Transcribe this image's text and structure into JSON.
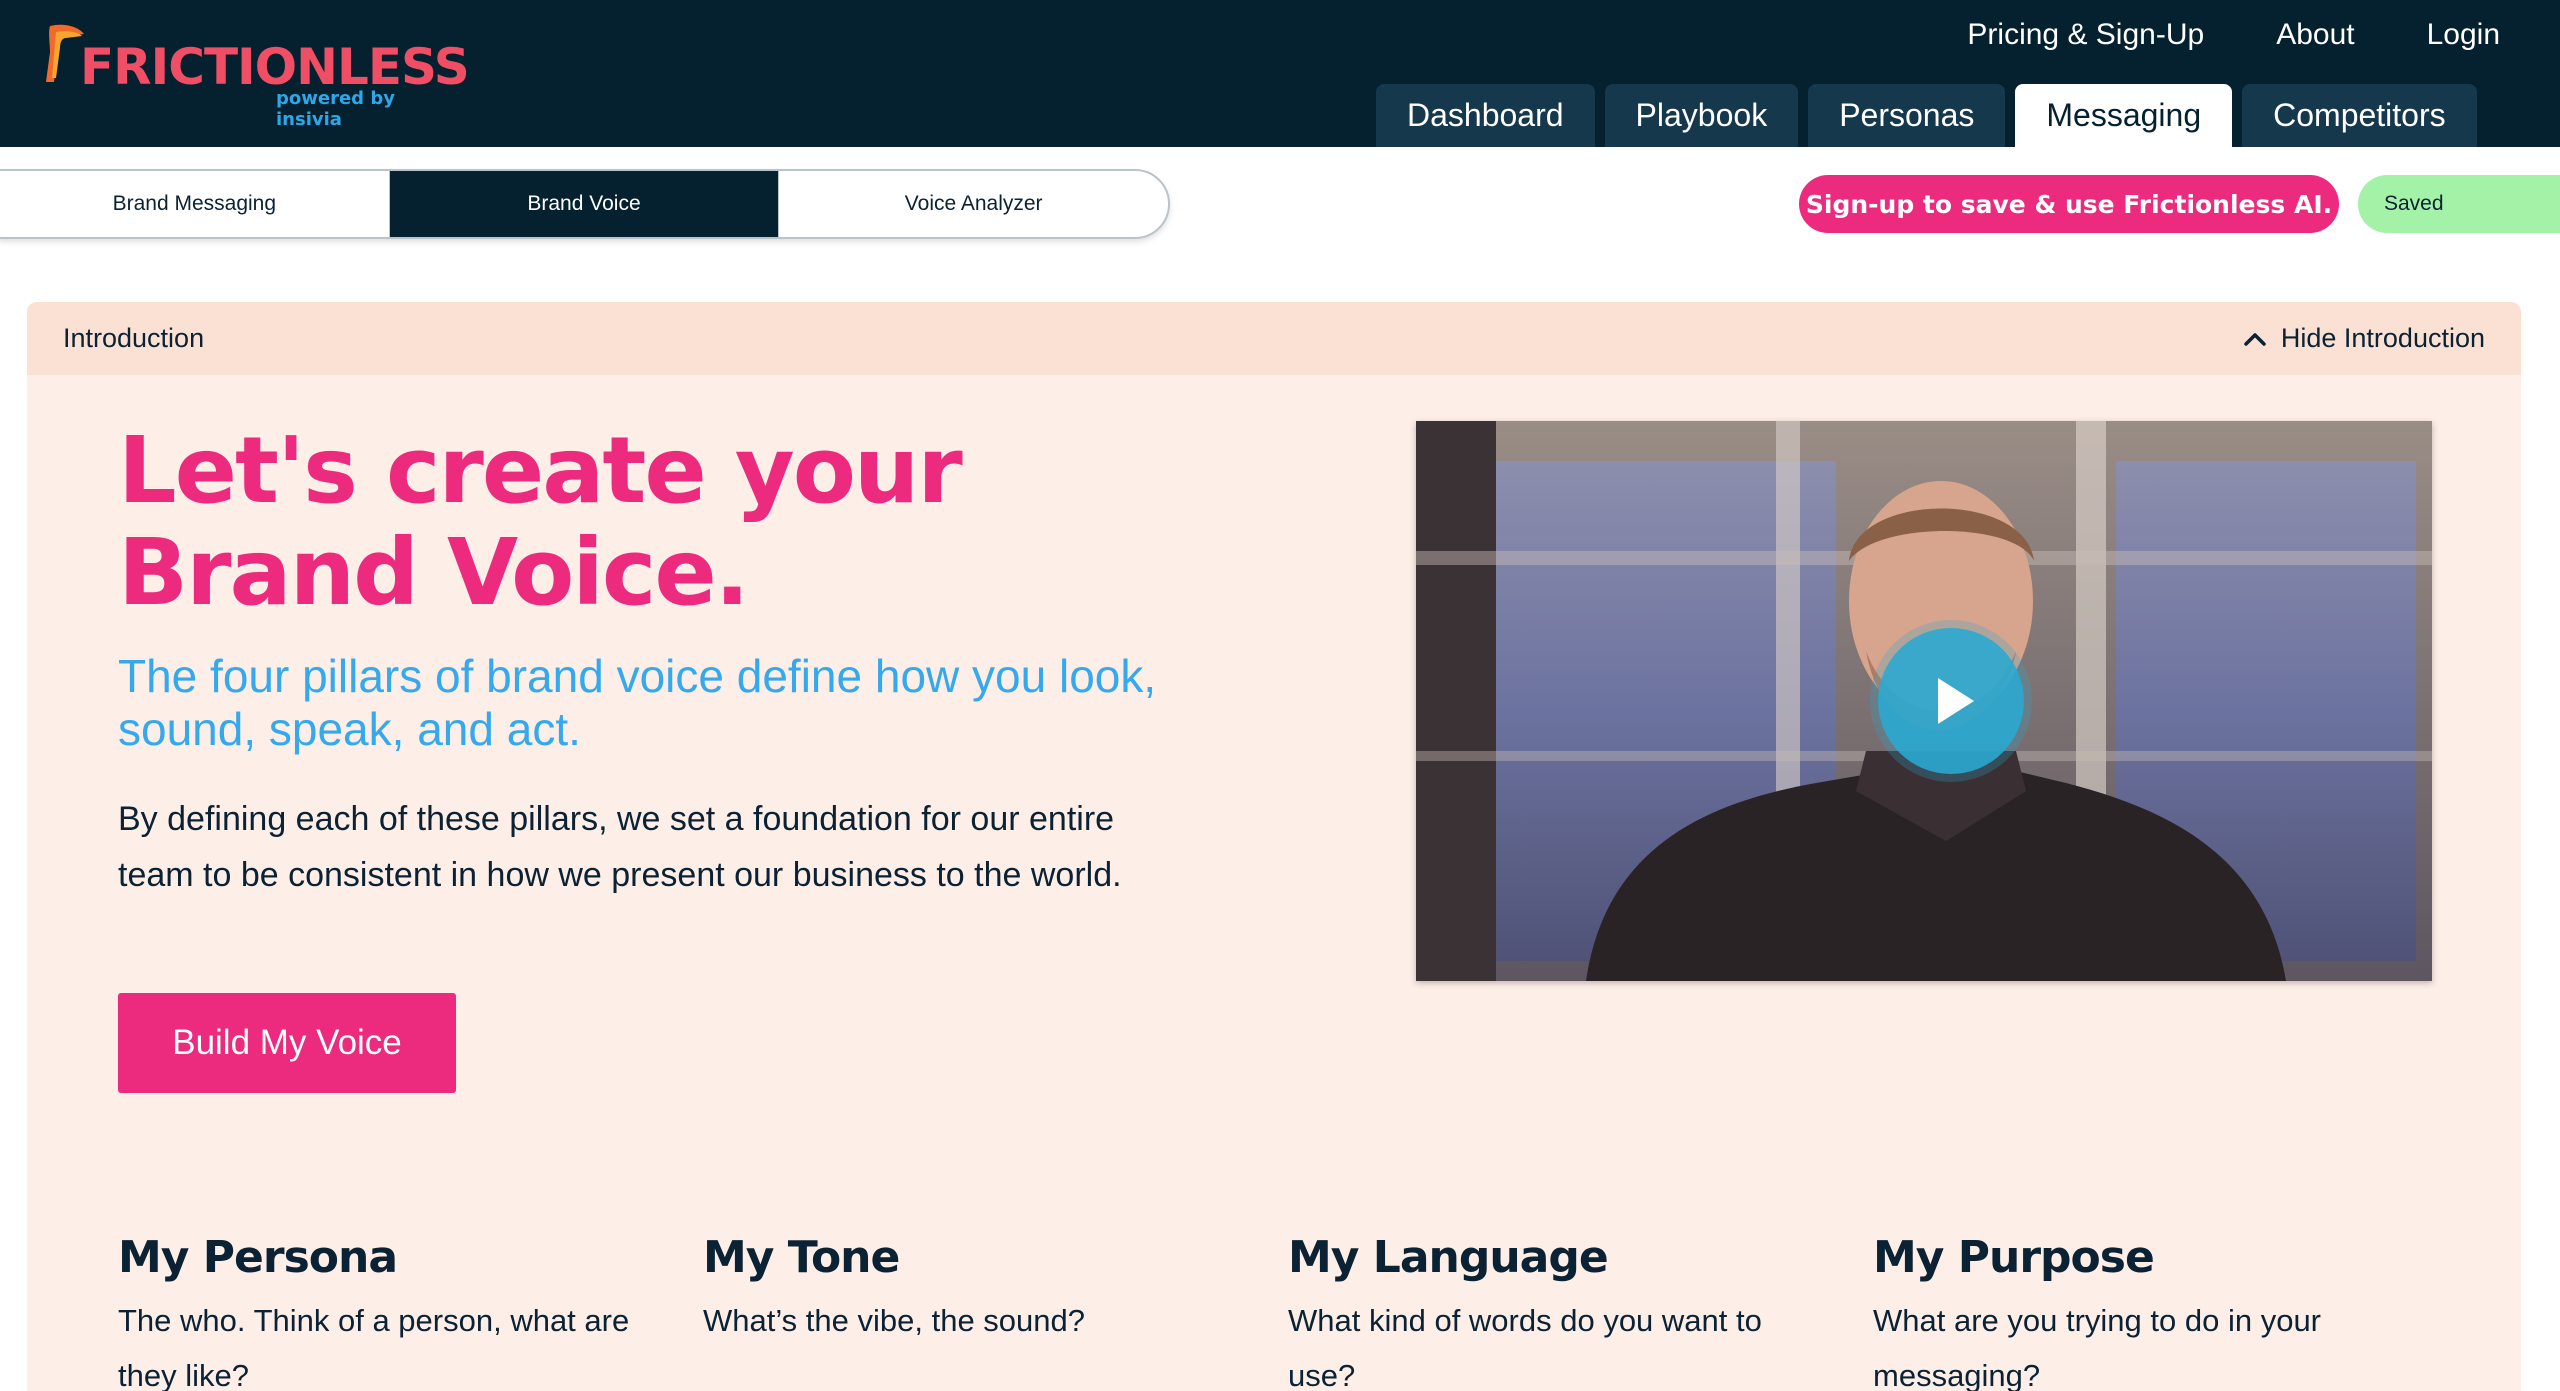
{
  "header": {
    "logo_text": "FRICTIONLESS",
    "logo_tagline": "powered by insivia",
    "links": [
      "Pricing & Sign-Up",
      "About",
      "Login"
    ],
    "tabs": [
      {
        "label": "Dashboard",
        "active": false
      },
      {
        "label": "Playbook",
        "active": false
      },
      {
        "label": "Personas",
        "active": false
      },
      {
        "label": "Messaging",
        "active": true
      },
      {
        "label": "Competitors",
        "active": false
      }
    ]
  },
  "subnav": {
    "segments": [
      {
        "label": "Brand Messaging",
        "active": false
      },
      {
        "label": "Brand Voice",
        "active": true
      },
      {
        "label": "Voice Analyzer",
        "active": false
      }
    ],
    "signup_label": "Sign-up to save & use Frictionless AI.",
    "saved_label": "Saved"
  },
  "intro": {
    "bar_title": "Introduction",
    "hide_label": "Hide Introduction",
    "headline_line1": "Let's create your",
    "headline_line2": "Brand Voice.",
    "subhead": "The four pillars of brand voice define how you look, sound, speak, and act.",
    "body": "By defining each of these pillars, we set a foundation for our entire team to be consistent in how we present our business to the world.",
    "cta_label": "Build My Voice",
    "video_icon": "play-icon"
  },
  "pillars": [
    {
      "title": "My Persona",
      "desc": "The who. Think of a person, what are they like?"
    },
    {
      "title": "My Tone",
      "desc": "What’s the vibe, the sound?"
    },
    {
      "title": "My Language",
      "desc": "What kind of words do you want to use?"
    },
    {
      "title": "My Purpose",
      "desc": "What are you trying to do in your messaging?"
    }
  ],
  "colors": {
    "navy": "#05202f",
    "pink": "#ec2b7e",
    "blue": "#34a9ee",
    "peach": "#fdeee7",
    "saved_green": "#a4f2a8"
  }
}
